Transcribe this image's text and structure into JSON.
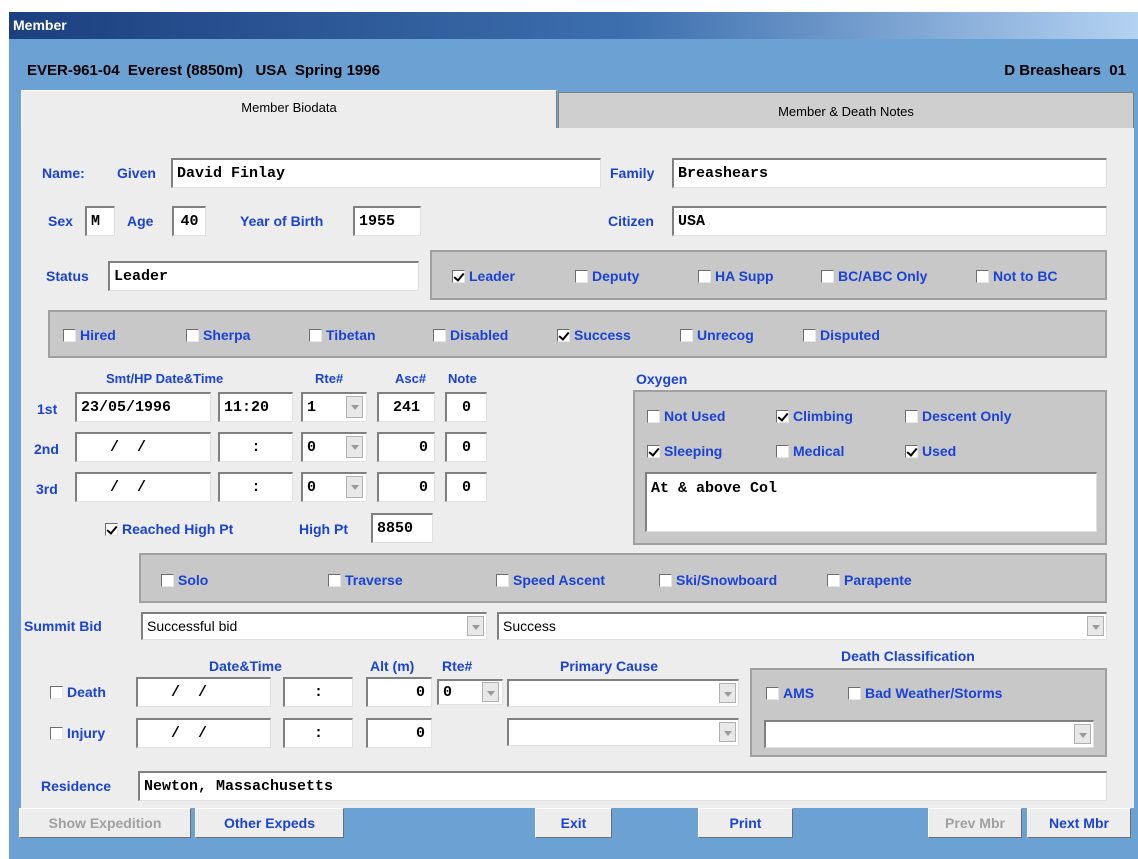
{
  "window": {
    "title": "Member"
  },
  "header": {
    "left": "EVER-961-04  Everest (8850m)   USA  Spring 1996",
    "right": "D Breashears  01"
  },
  "tabs": {
    "biodata": "Member Biodata",
    "notes": "Member & Death Notes"
  },
  "name": {
    "label": "Name:",
    "given_label": "Given",
    "given": "David Finlay",
    "family_label": "Family",
    "family": "Breashears"
  },
  "bio": {
    "sex_label": "Sex",
    "sex": "M",
    "age_label": "Age",
    "age": "40",
    "yob_label": "Year of Birth",
    "yob": "1955",
    "citizen_label": "Citizen",
    "citizen": "USA",
    "status_label": "Status",
    "status": "Leader"
  },
  "roles": {
    "leader": "Leader",
    "deputy": "Deputy",
    "hasupp": "HA Supp",
    "bcabc": "BC/ABC Only",
    "nottobc": "Not to BC"
  },
  "flags": {
    "hired": "Hired",
    "sherpa": "Sherpa",
    "tibetan": "Tibetan",
    "disabled": "Disabled",
    "success": "Success",
    "unrecog": "Unrecog",
    "disputed": "Disputed"
  },
  "summit": {
    "datetime_label": "Smt/HP Date&Time",
    "rte_label": "Rte#",
    "asc_label": "Asc#",
    "note_label": "Note",
    "row1_label": "1st",
    "row2_label": "2nd",
    "row3_label": "3rd",
    "rows": [
      {
        "date": "23/05/1996",
        "time": "11:20",
        "rte": "1",
        "asc": "241",
        "note": "0"
      },
      {
        "date": " /  /",
        "time": ":",
        "rte": "0",
        "asc": "0",
        "note": "0"
      },
      {
        "date": " /  /",
        "time": ":",
        "rte": "0",
        "asc": "0",
        "note": "0"
      }
    ],
    "reached": "Reached High Pt",
    "highpt_label": "High Pt",
    "highpt": "8850"
  },
  "oxygen": {
    "title": "Oxygen",
    "notused": "Not Used",
    "climbing": "Climbing",
    "descent": "Descent Only",
    "sleeping": "Sleeping",
    "medical": "Medical",
    "used": "Used",
    "note": "At & above Col"
  },
  "style": {
    "solo": "Solo",
    "traverse": "Traverse",
    "speed": "Speed Ascent",
    "ski": "Ski/Snowboard",
    "parapente": "Parapente"
  },
  "bid": {
    "label": "Summit Bid",
    "value": "Successful bid",
    "result": "Success"
  },
  "death": {
    "datetime_label": "Date&Time",
    "alt_label": "Alt (m)",
    "rte_label": "Rte#",
    "cause_label": "Primary Cause",
    "class_label": "Death Classification",
    "death": "Death",
    "injury": "Injury",
    "death_date": " /  /",
    "death_time": ":",
    "death_alt": "0",
    "death_rte": "0",
    "injury_date": " /  /",
    "injury_time": ":",
    "injury_alt": "0",
    "ams": "AMS",
    "weather": "Bad Weather/Storms"
  },
  "residence": {
    "label": "Residence",
    "value": "Newton, Massachusetts"
  },
  "buttons": {
    "show_exp": "Show Expedition",
    "other": "Other Expeds",
    "exit": "Exit",
    "print": "Print",
    "prev": "Prev Mbr",
    "next": "Next Mbr"
  }
}
